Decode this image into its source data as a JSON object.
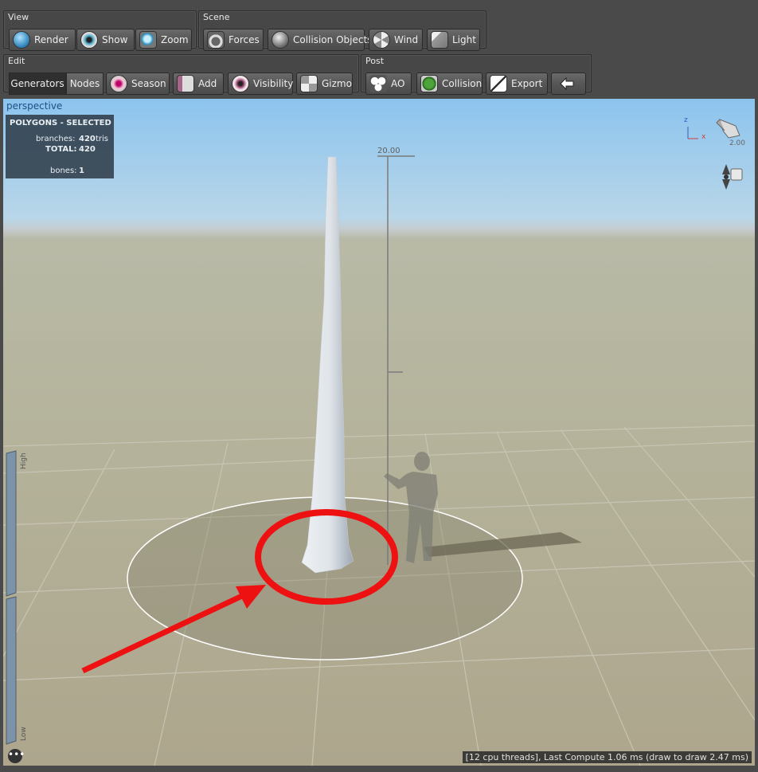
{
  "toolbar": {
    "view": {
      "title": "View",
      "buttons": [
        {
          "label": "Render",
          "icon": "globe-icon"
        },
        {
          "label": "Show",
          "icon": "eye-icon"
        },
        {
          "label": "Zoom",
          "icon": "magnifier-icon"
        }
      ]
    },
    "scene": {
      "title": "Scene",
      "buttons": [
        {
          "label": "Forces",
          "icon": "magnet-icon"
        },
        {
          "label": "Collision Objects",
          "icon": "sphere-icon"
        },
        {
          "label": "Wind",
          "icon": "fan-icon"
        },
        {
          "label": "Light",
          "icon": "spotlight-icon"
        }
      ]
    },
    "edit": {
      "title": "Edit",
      "tabs": [
        {
          "label": "Generators",
          "active": true
        },
        {
          "label": "Nodes",
          "active": false
        }
      ],
      "buttons": [
        {
          "label": "Season",
          "icon": "flower-icon"
        },
        {
          "label": "Add",
          "icon": "add-branch-icon"
        },
        {
          "label": "Visibility",
          "icon": "eyeball-icon"
        },
        {
          "label": "Gizmo",
          "icon": "gizmo-icon"
        }
      ]
    },
    "post": {
      "title": "Post",
      "buttons": [
        {
          "label": "AO",
          "icon": "circles-icon"
        },
        {
          "label": "Collision",
          "icon": "leaf-icon"
        },
        {
          "label": "Export",
          "icon": "export-icon"
        },
        {
          "label": "",
          "icon": "back-arrow-icon"
        }
      ]
    }
  },
  "viewport": {
    "camera_label": "perspective",
    "stats": {
      "header": "POLYGONS - SELECTED",
      "branches_label": "branches:",
      "branches_value": "420",
      "branches_unit": "tris",
      "total_label": "TOTAL:",
      "total_value": "420",
      "bones_label": "bones:",
      "bones_value": "1"
    },
    "scale_height_label": "20.00",
    "light_value": "2.00",
    "axis_z": "z",
    "axis_x": "x",
    "lod_high_label": "High",
    "lod_low_label": "Low",
    "status_text": "[12 cpu threads], Last Compute 1.06 ms (draw to draw 2.47 ms)",
    "menu_glyph": "•••"
  },
  "colors": {
    "annotation": "#ee1111",
    "sky_top": "#8cc4ee",
    "ground": "#b1ac94"
  }
}
